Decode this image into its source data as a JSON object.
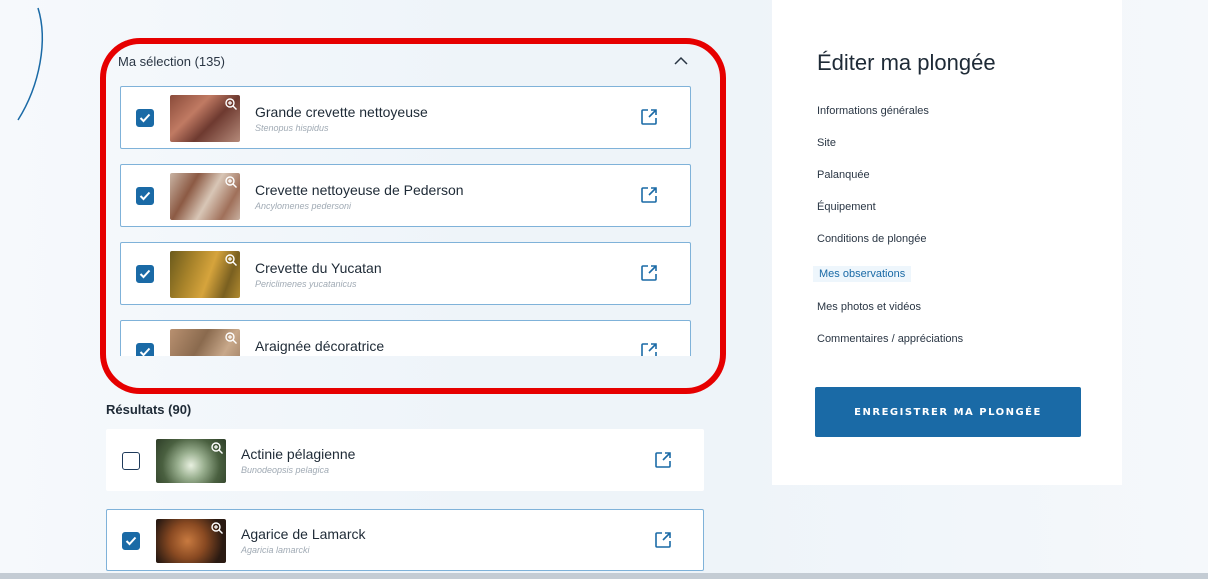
{
  "selection": {
    "title": "Ma sélection (135)",
    "items": [
      {
        "common": "Grande crevette nettoyeuse",
        "latin": "Stenopus hispidus",
        "checked": true
      },
      {
        "common": "Crevette nettoyeuse de Pederson",
        "latin": "Ancylomenes pedersoni",
        "checked": true
      },
      {
        "common": "Crevette du Yucatan",
        "latin": "Periclimenes yucatanicus",
        "checked": true
      },
      {
        "common": "Araignée décoratrice",
        "latin": "",
        "checked": true
      }
    ]
  },
  "results": {
    "title": "Résultats (90)",
    "items": [
      {
        "common": "Actinie pélagienne",
        "latin": "Bunodeopsis pelagica",
        "checked": false
      },
      {
        "common": "Agarice de Lamarck",
        "latin": "Agaricia lamarcki",
        "checked": true
      }
    ]
  },
  "side": {
    "title": "Éditer ma plongée",
    "nav": [
      "Informations générales",
      "Site",
      "Palanquée",
      "Équipement",
      "Conditions de plongée",
      "Mes observations",
      "Mes photos et vidéos",
      "Commentaires / appréciations"
    ],
    "active_index": 5,
    "save_label": "ENREGISTRER MA PLONGÉE"
  },
  "colors": {
    "accent": "#1a6aa6",
    "highlight_ring": "#e60000",
    "item_border": "#7fb2d9"
  },
  "icons": [
    "chevron-up-icon",
    "checkbox-checked-icon",
    "checkbox-empty-icon",
    "zoom-in-icon",
    "external-link-icon"
  ]
}
